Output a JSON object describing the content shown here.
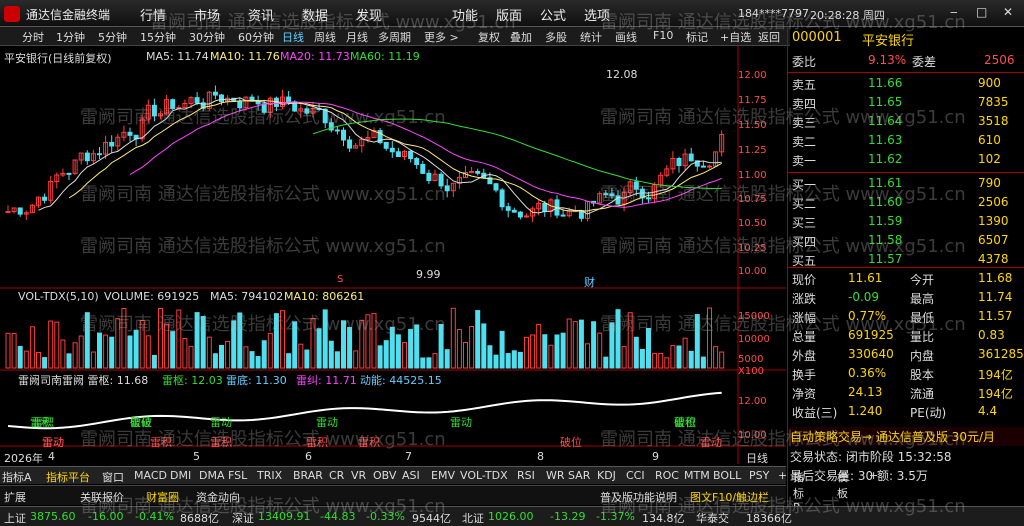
{
  "app": {
    "title": "通达信金融终端",
    "menus": [
      "行情",
      "市场",
      "资讯",
      "数据",
      "发现",
      "功能",
      "版面",
      "公式",
      "选项"
    ],
    "account": "184****7797",
    "clock": "20:28:28 周四",
    "win": [
      "‒",
      "□",
      "✕"
    ]
  },
  "toolbar": [
    "分时",
    "1分钟",
    "5分钟",
    "15分钟",
    "30分钟",
    "60分钟",
    "日线",
    "周线",
    "月线",
    "多周期",
    "更多 >",
    "复权",
    "叠加",
    "多股",
    "统计",
    "画线",
    "F10",
    "标记",
    "+自选",
    "返回"
  ],
  "main": {
    "ma_title": "平安银行(日线前复权)",
    "ma5": "MA5: 11.74",
    "ma10": "MA10: 11.76",
    "ma20": "MA20: 11.73",
    "ma60": "MA60: 11.19",
    "high_label": "12.08",
    "low_label": "9.99",
    "y_axis": [
      "12.00",
      "11.75",
      "11.50",
      "11.25",
      "11.00",
      "10.75",
      "10.50",
      "10.25",
      "10.00"
    ],
    "markers": [
      "S",
      "财"
    ]
  },
  "vol": {
    "title": "VOL-TDX(5,10)",
    "volume": "VOLUME: 691925",
    "ma5": "MA5: 794102",
    "ma10": "MA10: 806261",
    "y_axis": [
      "15000",
      "10000",
      "5000",
      "X100"
    ]
  },
  "ind": {
    "title": "雷阙司南雷阙 雷枢: 11.68",
    "l1": "雷枢: 12.03",
    "l2": "雷底: 11.30",
    "l3": "雷纠: 11.71",
    "l4": "动能: 44525.15",
    "y_axis": [
      "12.00",
      "10.00"
    ],
    "tags": [
      "雷积",
      "雷动",
      "雷破",
      "雷积",
      "雷动",
      "雷积",
      "雷动",
      "雷积",
      "雷动",
      "破位",
      "雷积",
      "雷动",
      "雷积",
      "雷动",
      "破位",
      "雷积",
      "破位"
    ]
  },
  "dates": {
    "year": "2026年",
    "months": [
      "4",
      "5",
      "6",
      "7",
      "8",
      "9"
    ],
    "period": "日线"
  },
  "tabs1": [
    "指标A",
    "指标平台",
    "窗口",
    "MACD",
    "DMI",
    "DMA",
    "FSL",
    "TRIX",
    "BRAR",
    "CR",
    "VR",
    "OBV",
    "ASI",
    "EMV",
    "VOL-TDX",
    "RSI",
    "WR",
    "SAR",
    "KDJ",
    "CCI",
    "ROC",
    "MTM",
    "BOLL",
    "PSY",
    "+",
    "指标B",
    "模板",
    "+"
  ],
  "tabs2": [
    "扩展",
    "关联报价",
    "财富圈",
    "资金动向"
  ],
  "quote": {
    "code": "000001",
    "name": "平安银行",
    "wb": "9.13%",
    "wc": "2506",
    "asks": [
      [
        "卖五",
        "11.66",
        "900"
      ],
      [
        "卖四",
        "11.65",
        "7835"
      ],
      [
        "卖三",
        "11.64",
        "3518"
      ],
      [
        "卖二",
        "11.63",
        "610"
      ],
      [
        "卖一",
        "11.62",
        "102"
      ]
    ],
    "bids": [
      [
        "买一",
        "11.61",
        "790"
      ],
      [
        "买二",
        "11.60",
        "2506"
      ],
      [
        "买三",
        "11.59",
        "1390"
      ],
      [
        "买四",
        "11.58",
        "6507"
      ],
      [
        "买五",
        "11.57",
        "4378"
      ]
    ],
    "stats": [
      [
        "现价",
        "11.61",
        "今开",
        "11.68"
      ],
      [
        "涨跌",
        "-0.09",
        "最高",
        "11.74"
      ],
      [
        "涨幅",
        "0.77%",
        "最低",
        "11.57"
      ],
      [
        "总量",
        "691925",
        "量比",
        "0.83"
      ],
      [
        "外盘",
        "330640",
        "内盘",
        "361285"
      ],
      [
        "换手",
        "0.36%",
        "股本",
        "194亿"
      ],
      [
        "净资",
        "24.13",
        "流通",
        "194亿"
      ],
      [
        "收益(三)",
        "1.240",
        "PE(动)",
        "4.4"
      ]
    ],
    "banner": "自动策略交易→ 通达信普及版 30元/月",
    "state": "交易状态: 闭市阶段 15:32:58",
    "last": "最后交易量: 30  额: 3.5万"
  },
  "bt2": [
    "普及版功能说明",
    "图文F10/触边栏"
  ],
  "status": {
    "sh": "上证",
    "sh_v": "3875.60",
    "sh_c": "-16.00",
    "sh_p": "-0.41%",
    "sh_a": "8688亿",
    "sz": "深证",
    "sz_v": "13409.91",
    "sz_c": "-44.83",
    "sz_p": "-0.33%",
    "sz_a": "9544亿",
    "bz": "北证",
    "bz_v": "1026.00",
    "bz_c": "-13.29",
    "bz_p": "-1.37%",
    "bz_a": "134.8亿",
    "broker": "华泰交",
    "total": "18366亿"
  },
  "watermark": "雷阙司南 通达信选股指标公式 www.xg51.cn"
}
